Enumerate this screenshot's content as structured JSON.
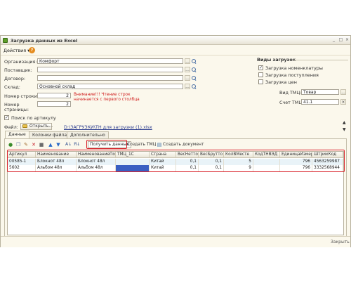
{
  "window": {
    "title": "Загрузка данных из Excel",
    "controls": [
      "_",
      "□",
      "×"
    ]
  },
  "menu": {
    "actions_label": "Действия ▾",
    "help_label": "?"
  },
  "form": {
    "organization": {
      "label": "Организация:",
      "value": "Комфорт"
    },
    "supplier": {
      "label": "Поставщик:",
      "value": ""
    },
    "contract": {
      "label": "Договор:",
      "value": ""
    },
    "warehouse": {
      "label": "Склад:",
      "value": "Основной склад"
    },
    "row_number": {
      "label": "Номер строки:",
      "value": "2"
    },
    "page_number": {
      "label_line1": "Номер",
      "label_line2": "страницы:",
      "value": "2"
    },
    "warning_line1": "Внимание!!! Чтение строк",
    "warning_line2": "начинается с первого столбца",
    "search_by_article": "Поиск по артикулу",
    "file_label": "Файл:",
    "open_button": "Открыть...",
    "file_path": "D:\\ЗАГРУЗКИ\\ТН для загрузки (1).xlsx",
    "tmc_type": {
      "label": "Вид ТМЦ:",
      "value": "Товар"
    },
    "tmc_account": {
      "label": "Счет ТМЦ:",
      "value": "41.1"
    },
    "ellipsis": "...",
    "clear": "×"
  },
  "load_types": {
    "title": "Виды загрузок",
    "items": [
      {
        "label": "Загрузка номенклатуры",
        "checked": true
      },
      {
        "label": "Загрузка поступления",
        "checked": false
      },
      {
        "label": "Загрузка цен",
        "checked": false
      }
    ]
  },
  "tabs": [
    {
      "label": "Данные",
      "active": true
    },
    {
      "label": "Колонки файла",
      "active": false
    },
    {
      "label": "Дополнительно",
      "active": false
    }
  ],
  "toolbar": {
    "get_data": "Получить данные",
    "create_tmc": "Создать ТМЦ",
    "create_document": "Создать документ"
  },
  "table": {
    "columns": [
      "Артикул",
      "Наименование",
      "НаименованиеПо...",
      "ТМЦ_1С",
      "Страна",
      "ВесНетто",
      "ВесБрутто",
      "КолВМесте",
      "КодТНВЭД",
      "ЕдиницаИзмер...",
      "ШтрихКод"
    ],
    "rows": [
      [
        "00585-1",
        "Блокнот 48л",
        "Блокнот 48л",
        "",
        "Китай",
        "0,1",
        "0,1",
        "5",
        "",
        "796",
        "4563259987"
      ],
      [
        "5602",
        "Альбом 48л",
        "Альбом 48л",
        "",
        "Китай",
        "0,1",
        "0,1",
        "9",
        "",
        "796",
        "3332568944"
      ]
    ]
  },
  "status": {
    "close_label": "Закрыть"
  },
  "colors": {
    "accent_red": "#d9212a",
    "selected_cell": "#3a5fc2",
    "row_highlight": "#e9f3f8"
  }
}
